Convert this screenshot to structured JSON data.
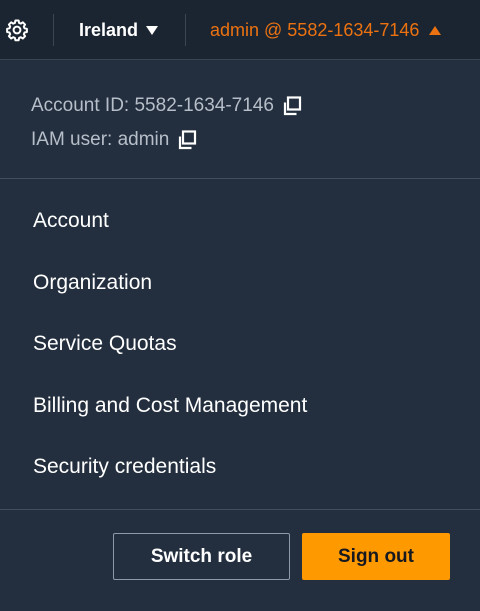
{
  "topbar": {
    "settings_icon": "gear-icon",
    "region_label": "Ireland",
    "account_label": "admin @ 5582-1634-7146"
  },
  "account_info": {
    "account_id_line": "Account ID: 5582-1634-7146",
    "iam_user_line": "IAM user: admin"
  },
  "menu": {
    "items": [
      {
        "label": "Account"
      },
      {
        "label": "Organization"
      },
      {
        "label": "Service Quotas"
      },
      {
        "label": "Billing and Cost Management"
      },
      {
        "label": "Security credentials"
      }
    ]
  },
  "actions": {
    "switch_role_label": "Switch role",
    "sign_out_label": "Sign out"
  },
  "colors": {
    "background": "#232f3e",
    "accent_orange": "#ec7211",
    "sign_out_bg": "#ff9900"
  }
}
